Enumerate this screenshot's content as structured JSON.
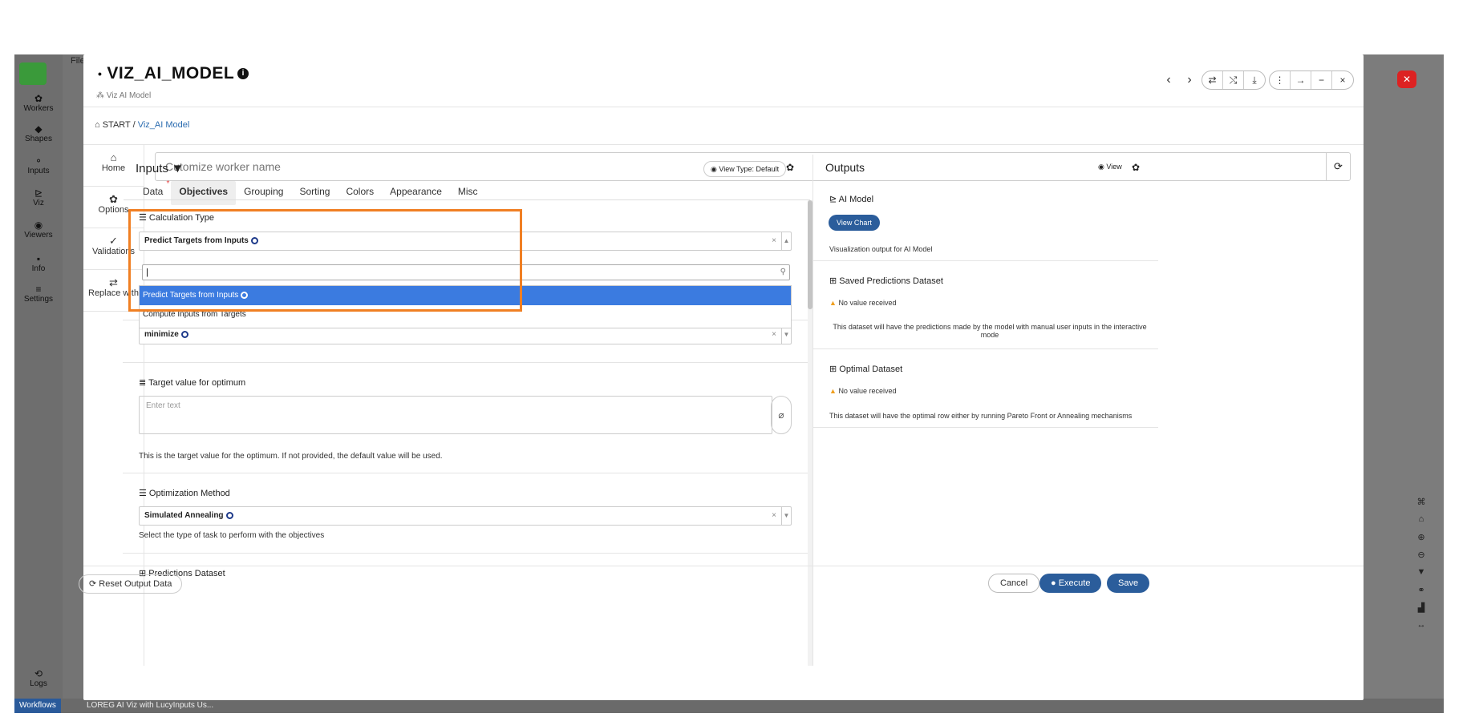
{
  "background": {
    "top_text": "File",
    "sidebar_items": [
      {
        "icon": "gear-icon",
        "glyph": "✿",
        "label": "Workers"
      },
      {
        "icon": "shapes-icon",
        "glyph": "◆",
        "label": "Shapes"
      },
      {
        "icon": "inputs-icon",
        "glyph": "⚬",
        "label": "Inputs"
      },
      {
        "icon": "viz-icon",
        "glyph": "⊵",
        "label": "Viz"
      },
      {
        "icon": "viewers-icon",
        "glyph": "◉",
        "label": "Viewers"
      },
      {
        "icon": "info-icon",
        "glyph": "▪",
        "label": "Info"
      },
      {
        "icon": "settings-icon",
        "glyph": "≡",
        "label": "Settings"
      }
    ],
    "logs_label": "Logs",
    "workflows_label": "Workflows",
    "workflow_tab": "LOREG AI Viz with LucyInputs Us..."
  },
  "modal": {
    "title": "VIZ_AI_MODEL",
    "subtitle": "Viz AI Model",
    "breadcrumb": {
      "root": "START",
      "current": "Viz_AI Model"
    },
    "name_placeholder": "Cutomize worker name",
    "left_nav": [
      {
        "icon": "home-icon",
        "glyph": "⌂",
        "label": "Home"
      },
      {
        "icon": "options-icon",
        "glyph": "✿",
        "label": "Options"
      },
      {
        "icon": "validations-icon",
        "glyph": "✓",
        "label": "Validations"
      },
      {
        "icon": "replace-icon",
        "glyph": "⇄",
        "label": "Replace with"
      }
    ]
  },
  "inputs": {
    "title": "Inputs",
    "view_type": "View Type: Default",
    "tabs": [
      "Data",
      "Objectives",
      "Grouping",
      "Sorting",
      "Colors",
      "Appearance",
      "Misc"
    ],
    "active_tab": "Objectives",
    "calculation_type": {
      "label": "Calculation Type",
      "value": "Predict Targets from Inputs",
      "options": [
        "Predict Targets from Inputs",
        "Compute Inputs from Targets"
      ]
    },
    "direction_value": "minimize",
    "target_value": {
      "label": "Target value for optimum",
      "placeholder": "Enter text",
      "help": "This is the target value for the optimum. If not provided, the default value will be used."
    },
    "optimization_method": {
      "label": "Optimization Method",
      "value": "Simulated Annealing",
      "help": "Select the type of task to perform with the objectives"
    },
    "predictions_dataset_label": "Predictions Dataset"
  },
  "outputs": {
    "title": "Outputs",
    "view_label": "View",
    "ai_model": {
      "title": "AI Model",
      "button": "View Chart",
      "desc": "Visualization output for AI Model"
    },
    "saved_predictions": {
      "title": "Saved Predictions Dataset",
      "warning": "No value received",
      "desc": "This dataset will have the predictions made by the model with manual user inputs in the interactive mode"
    },
    "optimal_dataset": {
      "title": "Optimal Dataset",
      "warning": "No value received",
      "desc": "This dataset will have the optimal row either by running Pareto Front or Annealing mechanisms"
    }
  },
  "footer": {
    "reset": "Reset Output Data",
    "cancel": "Cancel",
    "execute": "Execute",
    "save": "Save"
  },
  "colors": {
    "primary": "#2b5d9b",
    "highlight": "#f07f23",
    "selected_option": "#3b7be0"
  }
}
